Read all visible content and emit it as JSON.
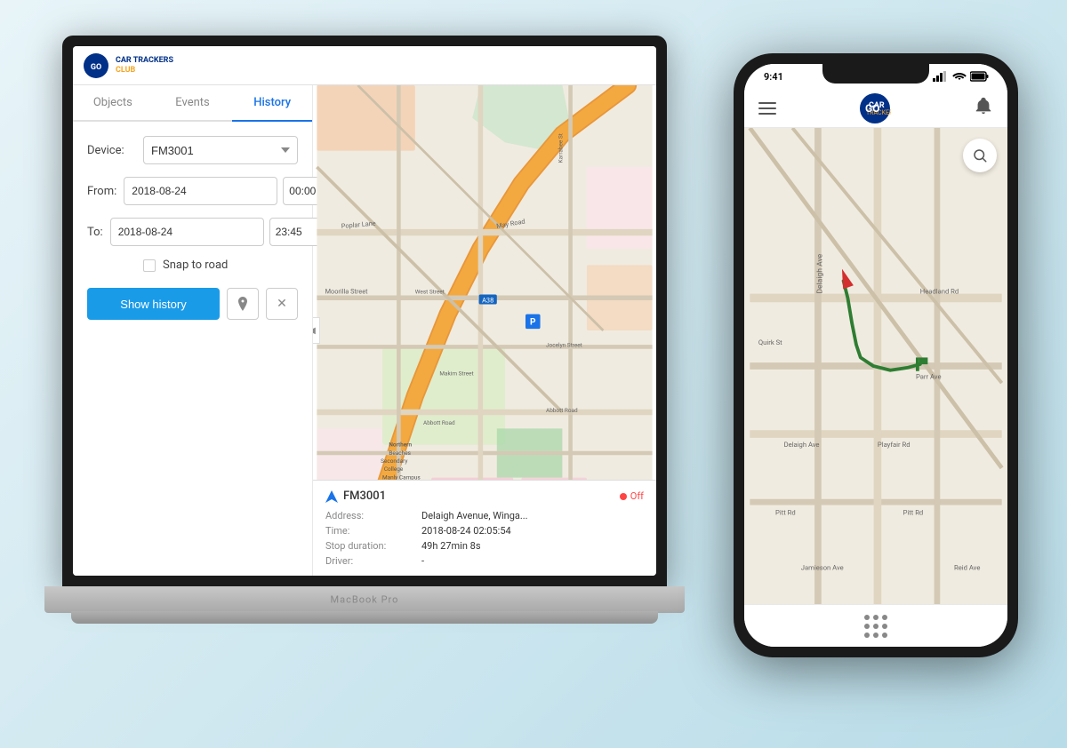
{
  "brand": {
    "logo_text_line1": "CAR TRACKERS",
    "logo_text_line2": "CLUB",
    "logo_letter": "GO"
  },
  "laptop": {
    "label": "MacBook Pro"
  },
  "tabs": [
    {
      "id": "objects",
      "label": "Objects"
    },
    {
      "id": "events",
      "label": "Events"
    },
    {
      "id": "history",
      "label": "History"
    }
  ],
  "form": {
    "device_label": "Device:",
    "device_value": "FM3001",
    "from_label": "From:",
    "from_date": "2018-08-24",
    "from_time": "00:00",
    "to_label": "To:",
    "to_date": "2018-08-24",
    "to_time": "23:45",
    "snap_label": "Snap to road",
    "show_button": "Show history"
  },
  "popup": {
    "device_name": "FM3001",
    "status": "Off",
    "fields": [
      {
        "key": "Address:",
        "value": "Delaigh Avenue, Winga..."
      },
      {
        "key": "Time:",
        "value": "2018-08-24 02:05:54"
      },
      {
        "key": "Stop duration:",
        "value": "49h 27min 8s"
      },
      {
        "key": "Driver:",
        "value": "-"
      }
    ]
  },
  "phone": {
    "time": "9:41",
    "signal_bars": "▂▄▆",
    "wifi": "WiFi",
    "battery": "🔋"
  }
}
